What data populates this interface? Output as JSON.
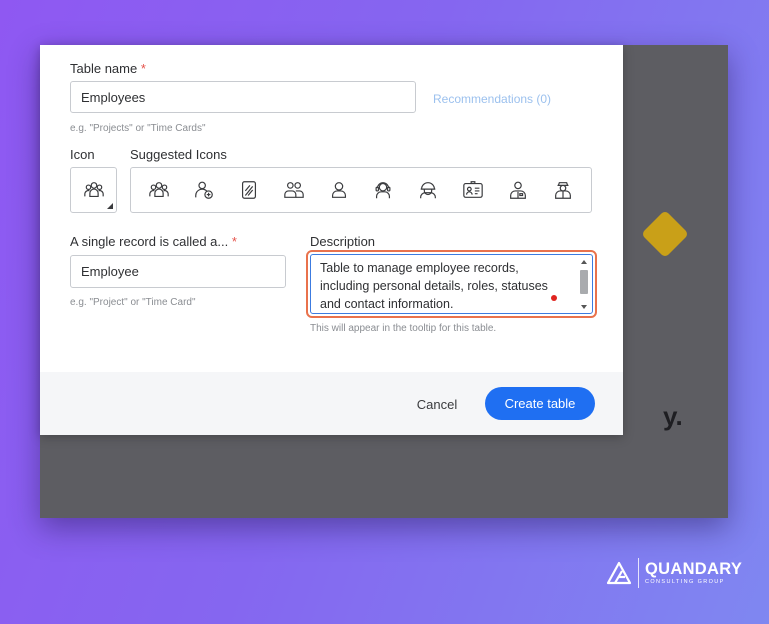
{
  "background_app": {
    "heading_fragment": "y."
  },
  "dialog": {
    "table_name": {
      "label": "Table name",
      "required_mark": "*",
      "value": "Employees",
      "hint": "e.g. \"Projects\" or \"Time Cards\"",
      "recommendations_link": "Recommendations (0)"
    },
    "icon": {
      "label": "Icon",
      "selected": "people-group-icon"
    },
    "suggested_icons": {
      "label": "Suggested Icons",
      "items": [
        "people-group-icon",
        "person-add-icon",
        "notebook-icon",
        "two-people-icon",
        "person-icon",
        "person-headset-icon",
        "person-helmet-icon",
        "id-card-icon",
        "person-badge-icon",
        "person-cap-icon"
      ]
    },
    "single_record": {
      "label": "A single record is called a...",
      "required_mark": "*",
      "value": "Employee",
      "hint": "e.g. \"Project\" or \"Time Card\""
    },
    "description": {
      "label": "Description",
      "value": "Table to manage employee records, including personal details, roles, statuses and contact information.",
      "hint": "This will appear in the tooltip for this table."
    },
    "footer": {
      "cancel_label": "Cancel",
      "create_label": "Create table"
    }
  },
  "branding": {
    "name": "QUANDARY",
    "tagline": "CONSULTING GROUP"
  },
  "colors": {
    "primary": "#1f6ff2",
    "focus_highlight": "#e9724c",
    "required": "#e5534b",
    "background_gradient_start": "#8f58f2",
    "background_gradient_end": "#7f87f1"
  }
}
